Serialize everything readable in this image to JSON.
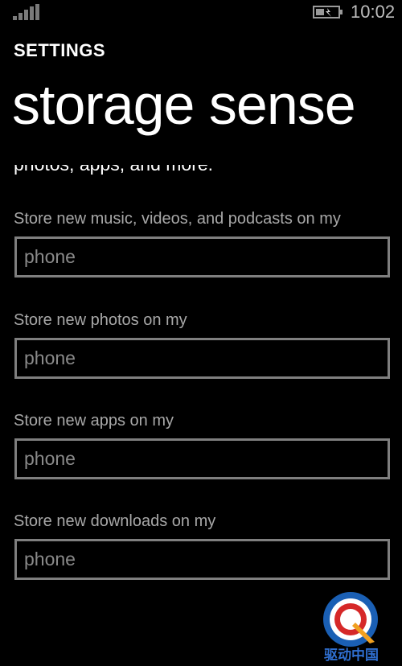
{
  "status_bar": {
    "time": "10:02",
    "signal_icon": "signal-strength-icon",
    "battery_icon": "battery-charging-icon"
  },
  "header": {
    "app_label": "SETTINGS",
    "page_title": "storage sense"
  },
  "intro_text": "photos, apps, and more.",
  "settings": [
    {
      "label": "Store new music, videos, and podcasts on my",
      "value": "phone"
    },
    {
      "label": "Store new photos on my",
      "value": "phone"
    },
    {
      "label": "Store new apps on my",
      "value": "phone"
    },
    {
      "label": "Store new downloads on my",
      "value": "phone"
    }
  ],
  "watermark": {
    "text": "驱动中国",
    "icon": "qd-logo-watermark"
  },
  "colors": {
    "background": "#000000",
    "text": "#ffffff",
    "label": "#a8a8a8",
    "field_border": "#7f7f7f",
    "field_value": "#8a8a8a"
  }
}
